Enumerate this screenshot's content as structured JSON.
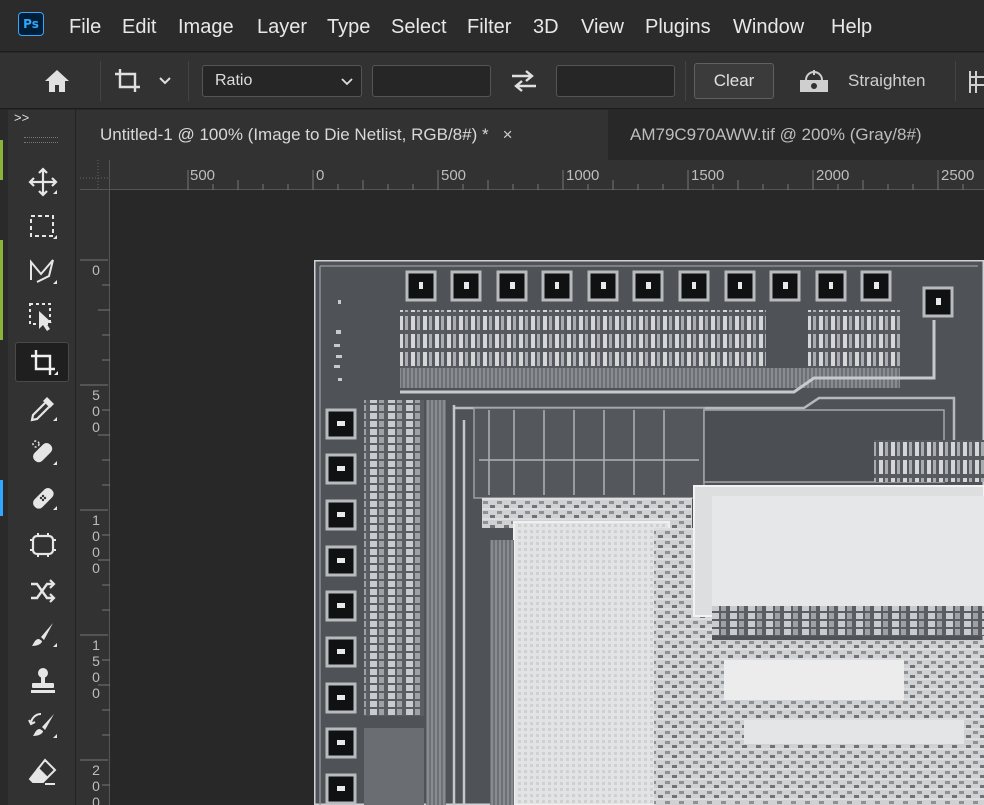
{
  "app": {
    "logo_text": "Ps"
  },
  "menu": {
    "items": [
      "File",
      "Edit",
      "Image",
      "Layer",
      "Type",
      "Select",
      "Filter",
      "3D",
      "View",
      "Plugins",
      "Window",
      "Help"
    ]
  },
  "options": {
    "ratio_label": "Ratio",
    "width_value": "",
    "height_value": "",
    "clear_label": "Clear",
    "straighten_label": "Straighten"
  },
  "panel": {
    "collapse_label": ">>"
  },
  "tools": [
    {
      "name": "move-tool",
      "icon": "move-icon"
    },
    {
      "name": "rectangular-marquee-tool",
      "icon": "marquee-icon"
    },
    {
      "name": "lasso-tool",
      "icon": "lasso-icon"
    },
    {
      "name": "object-selection-tool",
      "icon": "object-selection-icon"
    },
    {
      "name": "crop-tool",
      "icon": "crop-icon",
      "active": true
    },
    {
      "name": "eyedropper-tool",
      "icon": "eyedropper-icon"
    },
    {
      "name": "spot-healing-brush-tool",
      "icon": "spot-healing-icon"
    },
    {
      "name": "healing-brush-tool",
      "icon": "bandage-icon"
    },
    {
      "name": "patch-tool",
      "icon": "patch-icon"
    },
    {
      "name": "content-aware-move-tool",
      "icon": "content-aware-move-icon"
    },
    {
      "name": "brush-tool",
      "icon": "brush-icon"
    },
    {
      "name": "clone-stamp-tool",
      "icon": "stamp-icon"
    },
    {
      "name": "history-brush-tool",
      "icon": "history-brush-icon"
    },
    {
      "name": "eraser-tool",
      "icon": "eraser-icon"
    }
  ],
  "tabs": [
    {
      "title": "Untitled-1 @ 100% (Image to Die Netlist, RGB/8#) *",
      "close": "×",
      "active": true
    },
    {
      "title": "AM79C970AWW.tif @ 200% (Gray/8#)",
      "active": false
    }
  ],
  "rulers": {
    "horizontal": [
      "500",
      "0",
      "500",
      "1000",
      "1500",
      "2000",
      "2500"
    ],
    "vertical": [
      "0",
      "500",
      "1000",
      "1500",
      "2000"
    ]
  },
  "colors": {
    "accent": "#31a8ff",
    "panel": "#323232",
    "canvas": "#282828"
  }
}
